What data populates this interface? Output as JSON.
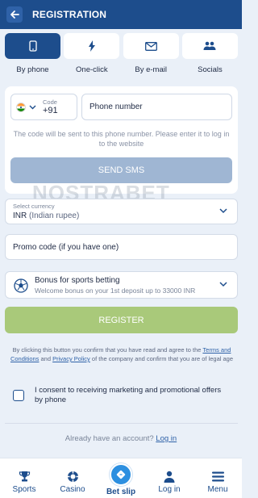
{
  "header": {
    "title": "REGISTRATION",
    "back_icon": "arrow-left-icon"
  },
  "tabs": [
    {
      "label": "By phone",
      "icon": "phone-icon",
      "active": true
    },
    {
      "label": "One-click",
      "icon": "lightning-icon",
      "active": false
    },
    {
      "label": "By e-mail",
      "icon": "envelope-icon",
      "active": false
    },
    {
      "label": "Socials",
      "icon": "people-icon",
      "active": false
    }
  ],
  "phone_form": {
    "code_label": "Code",
    "code_value": "+91",
    "phone_placeholder": "Phone number",
    "hint": "The code will be sent to this phone number. Please enter it to log in to the website",
    "send_sms_label": "SEND SMS"
  },
  "watermark": "NOSTRABET",
  "currency": {
    "label": "Select currency",
    "code": "INR",
    "name": "(Indian rupee)"
  },
  "promo": {
    "placeholder": "Promo code (if you have one)"
  },
  "bonus": {
    "title": "Bonus for sports betting",
    "description": "Welcome bonus on your 1st deposit up to 33000 INR"
  },
  "register_label": "REGISTER",
  "terms": {
    "text_1": "By clicking this button you confirm that you have read and agree to the",
    "link_1": "Terms and Conditions",
    "text_2": "and",
    "link_2": "Privacy Policy",
    "text_3": "of the company and confirm that you are of legal age"
  },
  "consent": {
    "text": "I consent to receiving marketing and promotional offers by phone",
    "checked": false
  },
  "login": {
    "prompt": "Already have an account?",
    "link": "Log in"
  },
  "bottom_nav": [
    {
      "label": "Sports",
      "icon": "trophy-icon"
    },
    {
      "label": "Casino",
      "icon": "casino-chip-icon"
    },
    {
      "label": "Bet slip",
      "icon": "ticket-icon",
      "active": true
    },
    {
      "label": "Log in",
      "icon": "user-icon"
    },
    {
      "label": "Menu",
      "icon": "hamburger-icon"
    }
  ],
  "colors": {
    "primary": "#1d4d8c",
    "send_sms": "#9fb6d3",
    "register": "#a9c97a",
    "link": "#2f62a8",
    "background": "#eaf0f8"
  }
}
